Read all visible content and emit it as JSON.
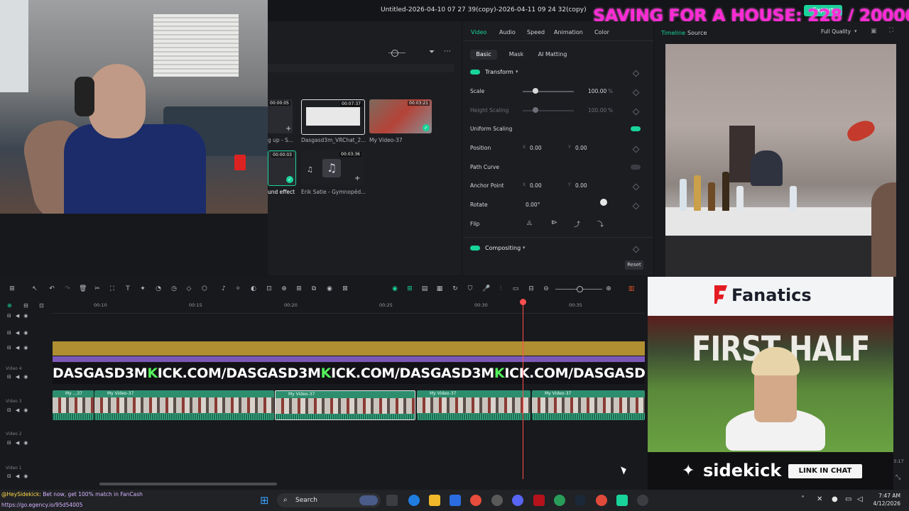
{
  "window": {
    "title": "Untitled-2026-04-10 07 27 39(copy)-2026-04-11 09 24 32(copy)",
    "export_label": "Export",
    "stream_banner": "SAVING FOR A HOUSE: 228 / 20000"
  },
  "media": {
    "items": [
      {
        "label": "g up - S...",
        "duration": "00:00:05"
      },
      {
        "label": "Dasgasd3m_VRChat_2...",
        "duration": "00:07:37"
      },
      {
        "label": "My Video-37",
        "duration": "00:03:21"
      },
      {
        "label": "und effect",
        "duration": "00:00:03"
      },
      {
        "label": "Erik Satie - Gymnopéd...",
        "duration": "00:03:36"
      }
    ]
  },
  "props": {
    "tabs": [
      "Video",
      "Audio",
      "Speed",
      "Animation",
      "Color"
    ],
    "active_tab": "Video",
    "subtabs": [
      "Basic",
      "Mask",
      "AI Matting"
    ],
    "active_subtab": "Basic",
    "transform_label": "Transform",
    "scale_label": "Scale",
    "scale_value": "100.00",
    "scale_unit": "%",
    "scale_fraction": 0.25,
    "height_scaling_label": "Height Scaling",
    "height_scaling_value": "100.00",
    "height_scaling_unit": "%",
    "uniform_scaling_label": "Uniform Scaling",
    "position_label": "Position",
    "position_x_label": "X",
    "position_x": "0.00",
    "position_y_label": "Y",
    "position_y": "0.00",
    "path_curve_label": "Path Curve",
    "anchor_label": "Anchor Point",
    "anchor_x_label": "X",
    "anchor_x": "0.00",
    "anchor_y_label": "Y",
    "anchor_y": "0.00",
    "rotate_label": "Rotate",
    "rotate_value": "0.00°",
    "flip_label": "Flip",
    "compositing_label": "Compositing",
    "reset_label": "Reset"
  },
  "preview": {
    "tabs": [
      "Timeline",
      "Source"
    ],
    "active_tab": "Timeline",
    "quality": "Full Quality"
  },
  "timeline": {
    "ruler_ticks": [
      "00:10",
      "00:15",
      "00:20",
      "00:25",
      "00:30",
      "00:35"
    ],
    "tracks": [
      "Video 4",
      "Video 3",
      "Video 2",
      "Video 1"
    ],
    "text_clip": {
      "parts": [
        "DASGASD3M",
        "K",
        "ICK.COM/DASGASD3M",
        "K",
        "ICK.COM/DASGASD3M",
        "K",
        "ICK.COM/DASGASD3M",
        "K",
        "IC"
      ]
    },
    "video_clips": [
      "My ...37",
      "My Video-37",
      "My Video-37",
      "My Video-37",
      "My Video-37"
    ],
    "side_time": "3:17"
  },
  "ad": {
    "brand": "Fanatics",
    "headline": "FIRST HALF",
    "sponsor": "sidekick",
    "cta": "LINK IN CHAT"
  },
  "taskbar": {
    "chat_user": "@HeySidekick:",
    "chat_message": " Bet now, get 100% match in FanCash",
    "chat_url": "https://go.egency.io/95d54005",
    "search_placeholder": "Search",
    "time": "7:47 AM",
    "date": "4/12/2026"
  },
  "colors": {
    "accent": "#18d49a",
    "banner": "#ff2bd6",
    "playhead": "#ff4f4f",
    "fanatics_red": "#e31b23"
  }
}
